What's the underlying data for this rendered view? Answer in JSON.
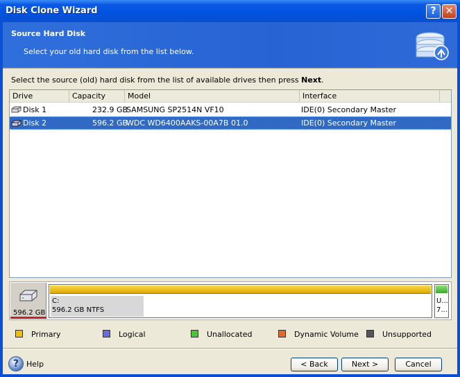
{
  "window": {
    "title": "Disk Clone Wizard"
  },
  "header": {
    "title": "Source Hard Disk",
    "subtitle": "Select your old hard disk from the list below.",
    "icon": "disk-clone-icon"
  },
  "instruction": {
    "text": "Select the source (old) hard disk from the list of available drives then press ",
    "emphasis": "Next",
    "suffix": "."
  },
  "table": {
    "columns": [
      "Drive",
      "Capacity",
      "Model",
      "Interface"
    ],
    "rows": [
      {
        "drive": "Disk 1",
        "capacity": "232.9 GB",
        "model": "SAMSUNG SP2514N VF10",
        "interface": "IDE(0) Secondary Master",
        "selected": false
      },
      {
        "drive": "Disk 2",
        "capacity": "596.2 GB",
        "model": "WDC WD6400AAKS-00A7B 01.0",
        "interface": "IDE(0) Secondary Master",
        "selected": true
      }
    ]
  },
  "disk_panel": {
    "disk_size": "596.2 GB",
    "partition_label": "C:",
    "partition_info": "596.2 GB  NTFS",
    "unallocated_line1": "U...",
    "unallocated_line2": "7..."
  },
  "legend": [
    {
      "label": "Primary",
      "color": "#f0c000"
    },
    {
      "label": "Logical",
      "color": "#6a6ae0"
    },
    {
      "label": "Unallocated",
      "color": "#50c040"
    },
    {
      "label": "Dynamic Volume",
      "color": "#e06a30"
    },
    {
      "label": "Unsupported",
      "color": "#555555"
    }
  ],
  "footer": {
    "help_label": "Help",
    "back_label": "< Back",
    "next_label": "Next >",
    "cancel_label": "Cancel"
  }
}
